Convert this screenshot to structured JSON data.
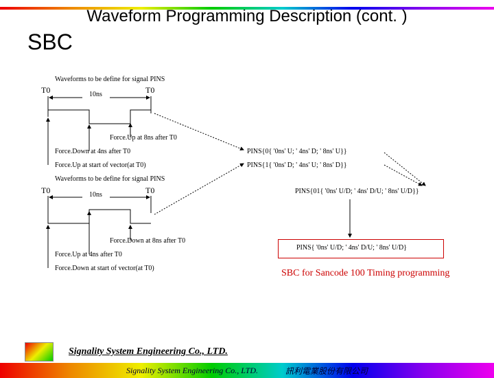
{
  "title": "Waveform Programming Description (cont. )",
  "section": "SBC",
  "diagram": {
    "wave_def_label_top": "Waveforms to be define for signal PINS",
    "wave_def_label_bottom": "Waveforms to be define for signal PINS",
    "t0": "T0",
    "period": "10ns",
    "force_up_8ns": "Force.Up at 8ns after T0",
    "force_down_4ns": "Force.Down at 4ns after T0",
    "force_up_start": "Force.Up at start of vector(at T0)",
    "force_down_8ns": "Force.Down at 8ns after T0",
    "force_up_4ns": "Force.Up at 4ns after T0",
    "force_down_start": "Force.Down at start of vector(at T0)",
    "pins0": "PINS{0{ '0ns' U; ' 4ns' D; ' 8ns' U}}",
    "pins1": "PINS{1{ '0ns' D; ' 4ns' U; ' 8ns' D}}",
    "pins01": "PINS{01{ '0ns' U/D; ' 4ns' D/U; ' 8ns' U/D}}",
    "pins_final": "PINS{ '0ns' U/D; ' 4ns' D/U; ' 8ns' U/D}",
    "sbc_note": "SBC for Sancode 100 Timing programming"
  },
  "company": "Signality System Engineering Co., LTD.",
  "footer_left": "Signality System Engineering Co., LTD.",
  "footer_right": "訊利電業股份有限公司"
}
